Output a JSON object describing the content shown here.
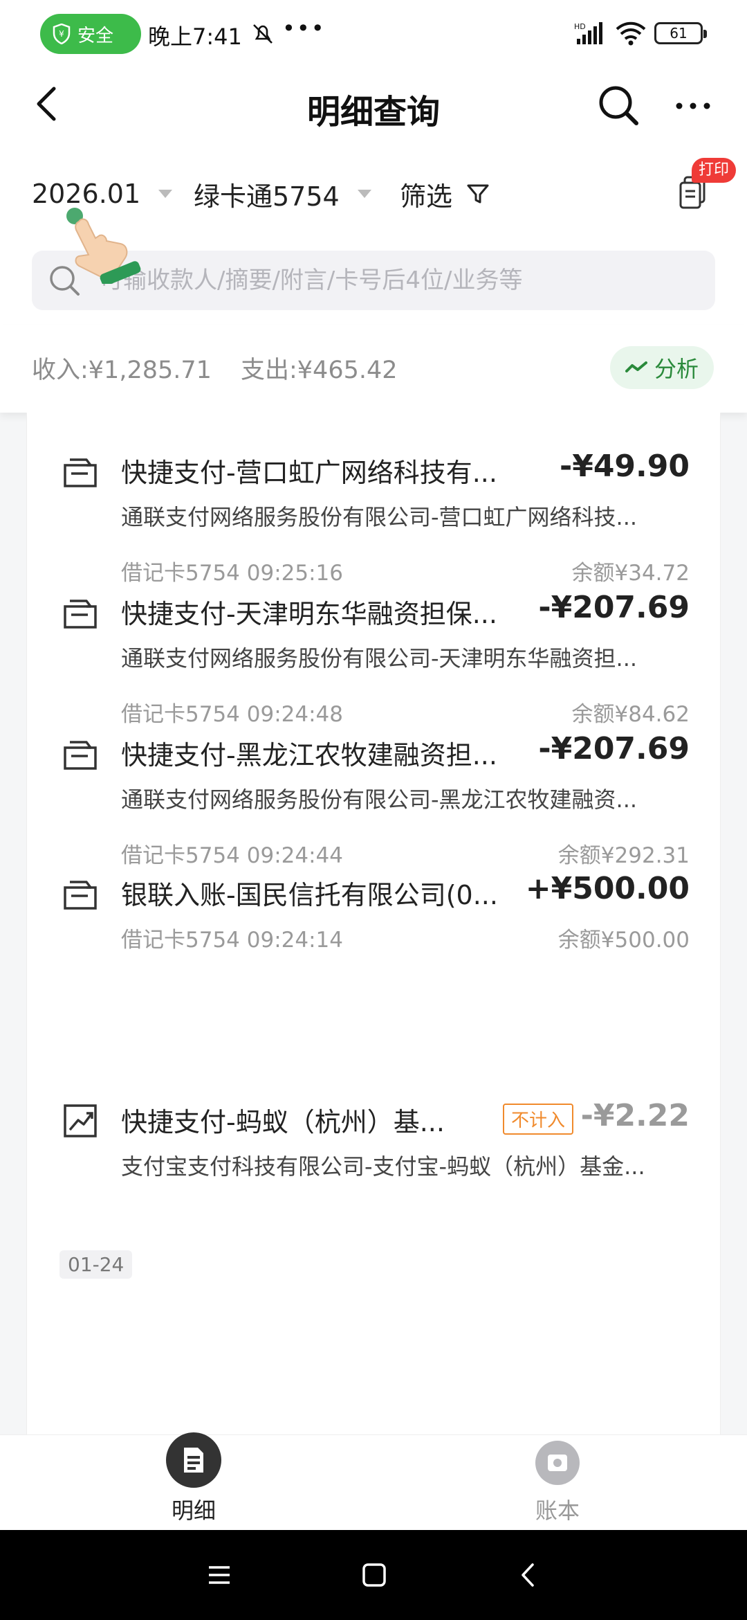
{
  "status_bar": {
    "safe_label": "安全",
    "time": "晚上7:41",
    "dots": "•••",
    "network": "HD",
    "battery": "61"
  },
  "header": {
    "title": "明细查询"
  },
  "filters": {
    "month": "2026.01",
    "card": "绿卡通5754",
    "filter_label": "筛选",
    "print_badge": "打印"
  },
  "search": {
    "placeholder": "可输收款人/摘要/附言/卡号后4位/业务等"
  },
  "summary": {
    "income": "收入:¥1,285.71",
    "expense": "支出:¥465.42",
    "analyze_label": "分析"
  },
  "transactions": [
    {
      "title": "快捷支付-营口虹广网络科技有...",
      "amount": "-¥49.90",
      "desc": "通联支付网络服务股份有限公司-营口虹广网络科技...",
      "meta": "借记卡5754 09:25:16",
      "balance": "余额¥34.72"
    },
    {
      "title": "快捷支付-天津明东华融资担保...",
      "amount": "-¥207.69",
      "desc": "通联支付网络服务股份有限公司-天津明东华融资担...",
      "meta": "借记卡5754 09:24:48",
      "balance": "余额¥84.62"
    },
    {
      "title": "快捷支付-黑龙江农牧建融资担...",
      "amount": "-¥207.69",
      "desc": "通联支付网络服务股份有限公司-黑龙江农牧建融资...",
      "meta": "借记卡5754 09:24:44",
      "balance": "余额¥292.31"
    },
    {
      "title": "银联入账-国民信托有限公司(0...",
      "amount": "+¥500.00",
      "meta": "借记卡5754 09:24:14",
      "balance": "余额¥500.00"
    },
    {
      "title": "快捷支付-蚂蚁（杭州）基...",
      "tag": "不计入",
      "amount": "-¥2.22",
      "desc": "支付宝支付科技有限公司-支付宝-蚂蚁（杭州）基金..."
    }
  ],
  "date_group": "01-24",
  "bottom_nav": {
    "detail_label": "明细",
    "book_label": "账本"
  },
  "colors": {
    "accent_green": "#3dbb4a",
    "tag_orange": "#f08a2c",
    "badge_red": "#ef3b37"
  }
}
